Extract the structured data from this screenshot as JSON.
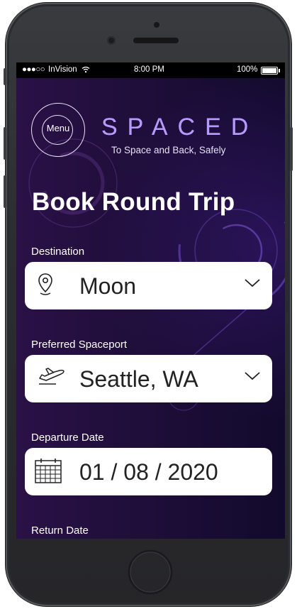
{
  "status_bar": {
    "signal": "●●●○○",
    "carrier": "InVision",
    "time": "8:00 PM",
    "battery": "100%"
  },
  "header": {
    "menu_label": "Menu",
    "logo": "SPACED",
    "tagline": "To Space and Back, Safely"
  },
  "page_title": "Book Round Trip",
  "form": {
    "destination": {
      "label": "Destination",
      "value": "Moon",
      "icon": "map-pin-icon"
    },
    "spaceport": {
      "label": "Preferred Spaceport",
      "value": "Seattle, WA",
      "icon": "airplane-takeoff-icon"
    },
    "departure": {
      "label": "Departure Date",
      "value": "01 / 08 / 2020",
      "icon": "calendar-icon"
    },
    "return": {
      "label": "Return Date"
    }
  },
  "colors": {
    "background": "#1f0e3a",
    "logo_accent": "#b89aff",
    "field_bg": "#ffffff"
  }
}
